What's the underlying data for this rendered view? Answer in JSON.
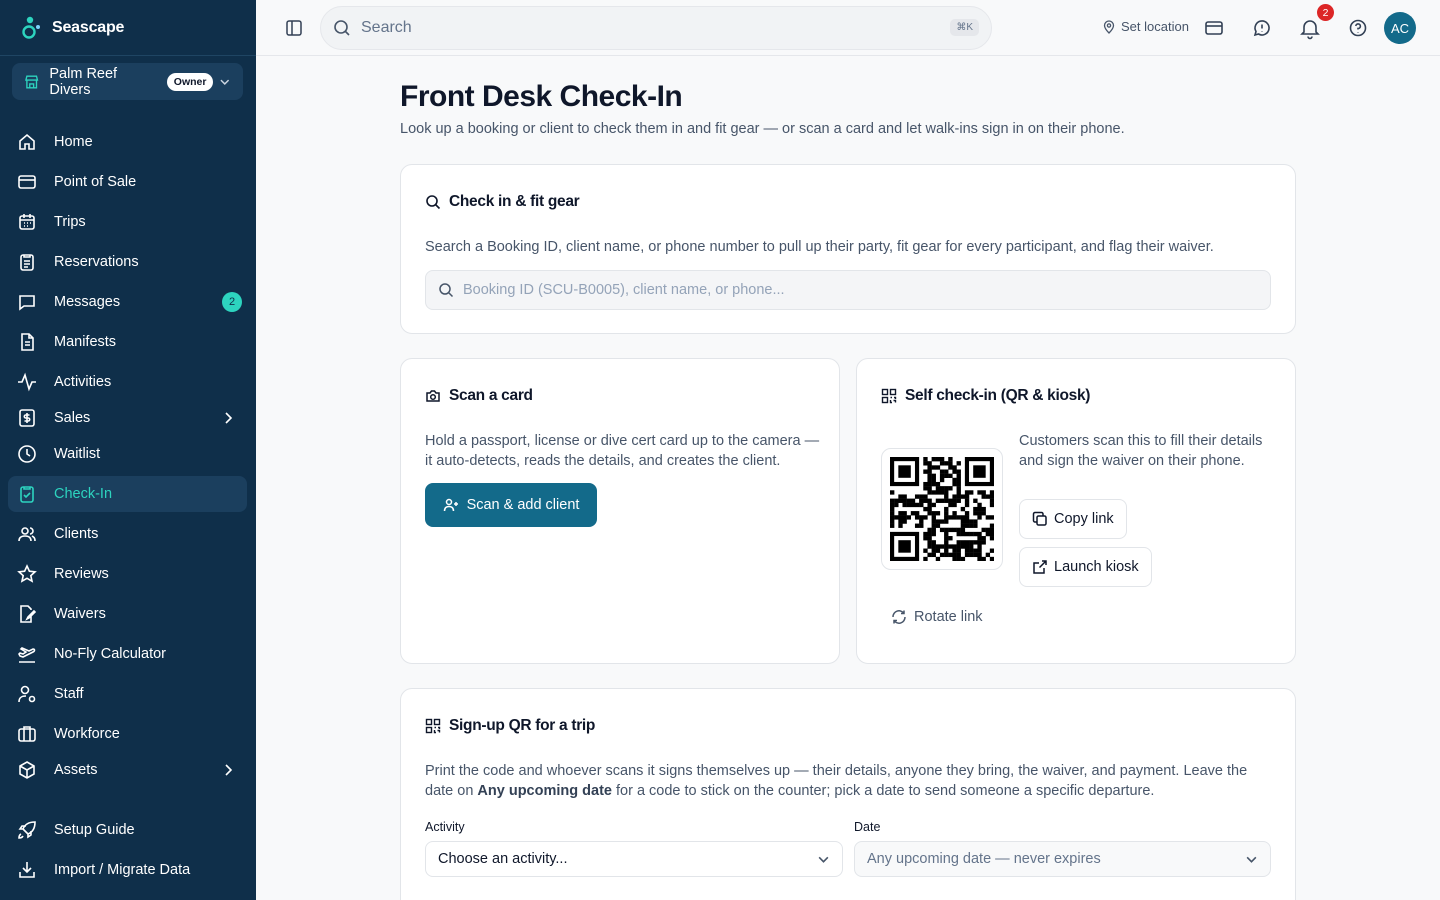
{
  "brand": {
    "name": "Seascape"
  },
  "org": {
    "name": "Palm Reef Divers",
    "role_badge": "Owner"
  },
  "nav": {
    "items": [
      {
        "label": "Home",
        "icon": "home-icon"
      },
      {
        "label": "Point of Sale",
        "icon": "credit-card-icon"
      },
      {
        "label": "Trips",
        "icon": "calendar-icon"
      },
      {
        "label": "Reservations",
        "icon": "clipboard-icon"
      },
      {
        "label": "Messages",
        "icon": "message-icon",
        "badge": "2"
      },
      {
        "label": "Manifests",
        "icon": "file-icon"
      },
      {
        "label": "Activities",
        "icon": "activity-icon"
      },
      {
        "label": "Sales",
        "icon": "receipt-icon"
      },
      {
        "label": "Waitlist",
        "icon": "clock-icon"
      },
      {
        "label": "Check-In",
        "icon": "clipboard-check-icon",
        "active": true
      },
      {
        "label": "Clients",
        "icon": "users-icon"
      },
      {
        "label": "Reviews",
        "icon": "star-icon"
      },
      {
        "label": "Waivers",
        "icon": "file-signature-icon"
      },
      {
        "label": "No-Fly Calculator",
        "icon": "plane-icon"
      },
      {
        "label": "Staff",
        "icon": "user-cog-icon"
      },
      {
        "label": "Workforce",
        "icon": "briefcase-icon"
      },
      {
        "label": "Assets",
        "icon": "box-icon"
      },
      {
        "label": "Setup Guide",
        "icon": "rocket-icon"
      },
      {
        "label": "Import / Migrate Data",
        "icon": "import-icon"
      }
    ]
  },
  "topbar": {
    "search_placeholder": "Search",
    "shortcut": "⌘K",
    "set_location": "Set location",
    "notification_count": "2",
    "avatar_initials": "AC"
  },
  "page": {
    "title": "Front Desk Check-In",
    "subtitle": "Look up a booking or client to check them in and fit gear — or scan a card and let walk-ins sign in on their phone."
  },
  "checkin_card": {
    "title": "Check in & fit gear",
    "description": "Search a Booking ID, client name, or phone number to pull up their party, fit gear for every participant, and flag their waiver.",
    "placeholder": "Booking ID (SCU-B0005), client name, or phone..."
  },
  "scan_card": {
    "title": "Scan a card",
    "description": "Hold a passport, license or dive cert card up to the camera — it auto-detects, reads the details, and creates the client.",
    "button": "Scan & add client"
  },
  "self_checkin": {
    "title": "Self check-in (QR & kiosk)",
    "description": "Customers scan this to fill their details and sign the waiver on their phone.",
    "copy_link": "Copy link",
    "launch_kiosk": "Launch kiosk",
    "rotate_link": "Rotate link"
  },
  "signup_qr": {
    "title": "Sign-up QR for a trip",
    "description_1": "Print the code and whoever scans it signs themselves up — their details, anyone they bring, the waiver, and payment. Leave the date on ",
    "description_bold": "Any upcoming date",
    "description_2": " for a code to stick on the counter; pick a date to send someone a specific departure.",
    "activity_label": "Activity",
    "activity_value": "Choose an activity...",
    "date_label": "Date",
    "date_value": "Any upcoming date — never expires"
  },
  "colors": {
    "sidebar_bg": "#0f2f4a",
    "accent_teal": "#2dd4bf",
    "primary": "#136a8a",
    "danger": "#dc2626"
  }
}
